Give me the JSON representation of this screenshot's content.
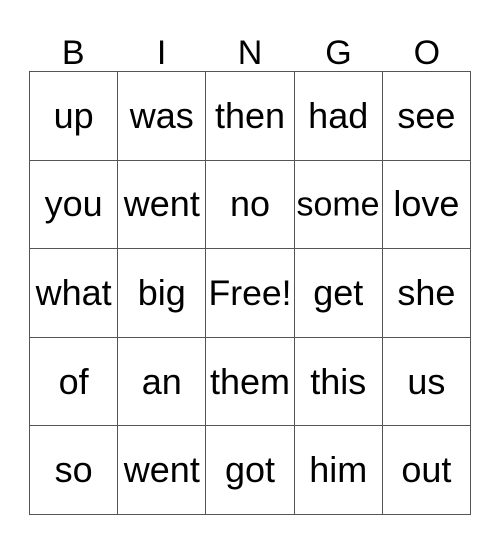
{
  "card": {
    "title_letters": [
      "B",
      "I",
      "N",
      "G",
      "O"
    ],
    "colors": {
      "background": "#ffffff",
      "text": "#000000",
      "grid_line": "#555555"
    },
    "grid": {
      "rows": 5,
      "columns": 5,
      "free_space_label": "Free!",
      "free_space_position": {
        "row": 3,
        "column": 3
      },
      "cells": [
        [
          "up",
          "was",
          "then",
          "had",
          "see"
        ],
        [
          "you",
          "went",
          "no",
          "some",
          "love"
        ],
        [
          "what",
          "big",
          "Free!",
          "get",
          "she"
        ],
        [
          "of",
          "an",
          "them",
          "this",
          "us"
        ],
        [
          "so",
          "went",
          "got",
          "him",
          "out"
        ]
      ]
    }
  }
}
